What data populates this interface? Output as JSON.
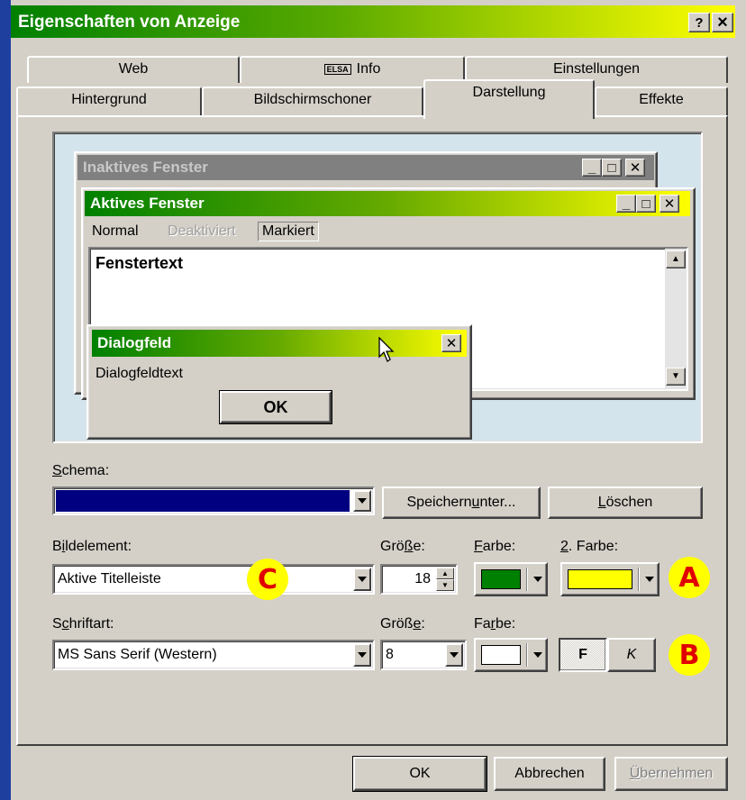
{
  "window": {
    "title": "Eigenschaften von Anzeige",
    "help_btn": "?",
    "close_btn": "×"
  },
  "tabs_back": [
    {
      "label": "Web"
    },
    {
      "label": "Info",
      "icon": "elsa-logo-icon",
      "icon_text": "ELSA"
    },
    {
      "label": "Einstellungen"
    }
  ],
  "tabs_front": [
    {
      "label": "Hintergrund"
    },
    {
      "label": "Bildschirmschoner"
    },
    {
      "label": "Darstellung",
      "active": true
    },
    {
      "label": "Effekte"
    }
  ],
  "preview": {
    "inactive_title": "Inaktives Fenster",
    "active_title": "Aktives Fenster",
    "menu": [
      "Normal",
      "Deaktiviert",
      "Markiert"
    ],
    "window_text": "Fenstertext",
    "dialog_title": "Dialogfeld",
    "dialog_text": "Dialogfeldtext",
    "dialog_ok": "OK"
  },
  "schema": {
    "label_u": "S",
    "label_rest": "chema:",
    "value": "",
    "save_as_pre": "Speichern ",
    "save_as_u": "u",
    "save_as_post": "nter...",
    "delete_u": "L",
    "delete_rest": "öschen"
  },
  "element": {
    "label_pre": "B",
    "label_u": "i",
    "label_post": "ldelement:",
    "value": "Aktive Titelleiste",
    "size_label_pre": "Grö",
    "size_label_u": "ß",
    "size_label_post": "e:",
    "size_value": "18",
    "color_label_u": "F",
    "color_label_rest": "arbe:",
    "color2_label_u": "2",
    "color2_label_rest": ". Farbe:"
  },
  "font": {
    "label_pre": "S",
    "label_u": "c",
    "label_post": "hriftart:",
    "value": "MS Sans Serif (Western)",
    "size_label_pre": "Größ",
    "size_label_u": "e",
    "size_label_post": ":",
    "size_value": "8",
    "color_label_pre": "Fa",
    "color_label_u": "r",
    "color_label_post": "be:",
    "bold_label": "F",
    "italic_label": "K"
  },
  "markers": {
    "a": "A",
    "b": "B",
    "c": "C"
  },
  "buttons": {
    "ok": "OK",
    "cancel": "Abbrechen",
    "apply_u": "Ü",
    "apply_rest": "bernehmen"
  },
  "colors": {
    "active_title_start": "#008000",
    "active_title_end": "#ffff00",
    "inactive_title": "#808080",
    "element_color": "#008000",
    "element_color2": "#ffff00",
    "font_color": "#ffffff",
    "schema_selection": "#000080"
  }
}
